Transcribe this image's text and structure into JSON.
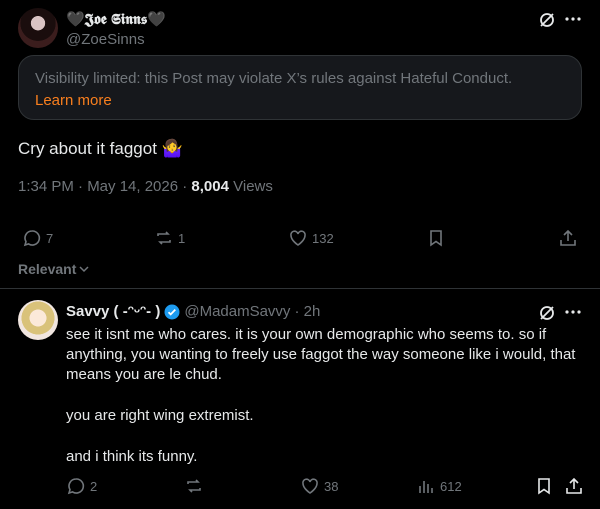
{
  "post": {
    "author_name": "🖤𝕵𝖔𝖊 𝕾𝖎𝖓𝖓𝖘🖤",
    "handle": "@ZoeSinns",
    "notice_text": "Visibility limited: this Post may violate X’s rules against Hateful Conduct.",
    "notice_link": "Learn more",
    "text": "Cry about it faggot 🤷‍♀️",
    "time": "1:34 PM · May 14, 2026 · ",
    "views_count": "8,004",
    "views_label": " Views",
    "replies": "7",
    "reposts": "1",
    "likes": "132"
  },
  "sort": {
    "label": "Relevant"
  },
  "reply": {
    "author_name": "Savvy ( -ᵔᵕᵔ- )",
    "handle": "@MadamSavvy",
    "time": "· 2h",
    "paragraphs": [
      "see it isnt me who cares. it is your own demographic who seems to. so if anything, you wanting to freely use faggot the way someone like i would, that means you are le chud.",
      "you are right wing extremist.",
      "and i think its funny."
    ],
    "replies": "2",
    "likes": "38",
    "views": "612"
  },
  "colors": {
    "accent": "#1d9bf0",
    "warning_link": "#f97f1e",
    "border": "#2f3336",
    "muted": "#71767b"
  },
  "icons": [
    "grok-icon",
    "more-icon",
    "reply-icon",
    "repost-icon",
    "like-icon",
    "bookmark-icon",
    "share-icon",
    "views-icon",
    "verified-badge-icon",
    "chevron-down-icon"
  ]
}
